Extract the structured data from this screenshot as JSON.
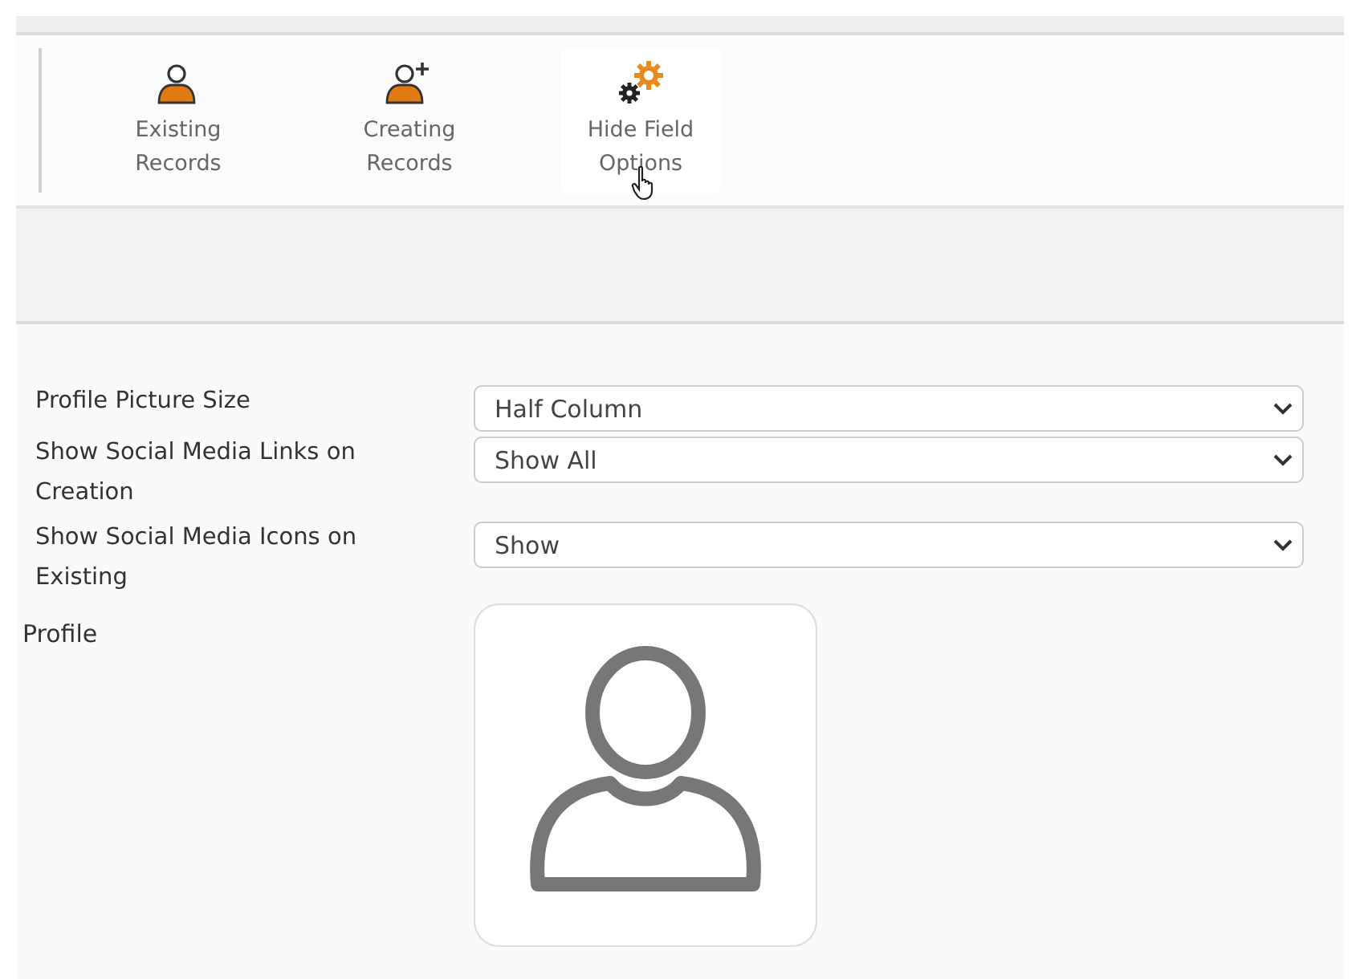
{
  "toolbar": {
    "buttons": [
      {
        "kind": "person",
        "label": "Existing Records",
        "hovered": false
      },
      {
        "kind": "person-add",
        "label": "Creating Records",
        "hovered": false
      },
      {
        "kind": "gears",
        "label": "Hide Field Options",
        "hovered": true
      }
    ]
  },
  "form": {
    "fields": [
      {
        "label": "Profile Picture Size",
        "value": "Half Column"
      },
      {
        "label": "Show Social Media Links on Creation",
        "value": "Show All"
      },
      {
        "label": "Show Social Media Icons on Existing",
        "value": "Show"
      }
    ],
    "profile": {
      "label": "Profile"
    }
  }
}
